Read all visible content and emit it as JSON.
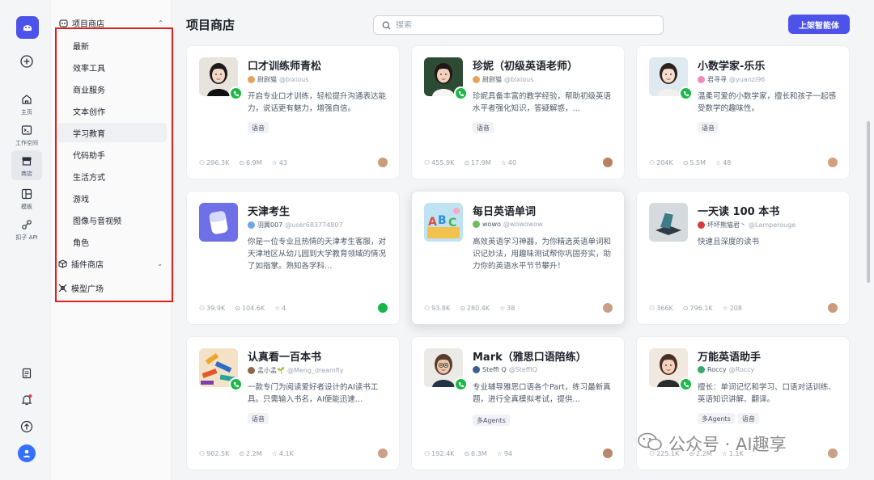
{
  "rail": {
    "items": [
      {
        "label": "主页"
      },
      {
        "label": "工作空间"
      },
      {
        "label": "商店"
      },
      {
        "label": "模板"
      },
      {
        "label": "扣子 API"
      }
    ]
  },
  "sidebar": {
    "project_store": "项目商店",
    "categories": [
      "最新",
      "效率工具",
      "商业服务",
      "文本创作",
      "学习教育",
      "代码助手",
      "生活方式",
      "游戏",
      "图像与音视频",
      "角色"
    ],
    "plugin_store": "插件商店",
    "model_square": "模型广场"
  },
  "header": {
    "title": "项目商店",
    "search_placeholder": "搜索",
    "publish_label": "上架智能体"
  },
  "cards": [
    {
      "title": "口才训练师青松",
      "author": "尉尉猫",
      "handle": "@bixious",
      "desc": "开启专业口才训练，轻松提升沟通表达能力，说话更有魅力，增强自信。",
      "tags": [
        "语音"
      ],
      "users": "296.3K",
      "chats": "6.9M",
      "stars": "43"
    },
    {
      "title": "珍妮（初级英语老师）",
      "author": "尉尉猫",
      "handle": "@bixious",
      "desc": "珍妮具备丰富的教学经验，帮助初级英语水平者强化知识，答疑解惑，…",
      "tags": [
        "语音"
      ],
      "users": "455.9K",
      "chats": "17.9M",
      "stars": "40"
    },
    {
      "title": "小数学家-乐乐",
      "author": "君寻寻",
      "handle": "@yuanzi96",
      "desc": "温柔可爱的小数学家，擅长和孩子一起感受数学的趣味性。",
      "tags": [
        "语音"
      ],
      "users": "204K",
      "chats": "5.5M",
      "stars": "48"
    },
    {
      "title": "天津考生",
      "author": "羽翼007",
      "handle": "@user683774807",
      "desc": "你是一位专业且热情的天津考生客服，对天津地区从幼儿园到大学教育领域的情况了如指掌。熟知各学科…",
      "tags": [],
      "users": "39.9K",
      "chats": "104.6K",
      "stars": "4"
    },
    {
      "title": "每日英语单词",
      "author": "wowo",
      "handle": "@wowowow",
      "desc": "高效英语学习神器，为你精选英语单词和识记妙法，用趣味测试帮你巩固夯实，助力你的英语水平节节攀升！",
      "tags": [],
      "users": "93.8K",
      "chats": "280.4K",
      "stars": "38"
    },
    {
      "title": "一天读 100 本书",
      "author": "坏坏熊猫君丶",
      "handle": "@Lamperouge",
      "desc": "快速且深度的读书",
      "tags": [],
      "users": "366K",
      "chats": "796.1K",
      "stars": "208"
    },
    {
      "title": "认真看一百本书",
      "author": "孟小孟🌱",
      "handle": "@Meng_dreamfly",
      "desc": "一款专门为阅读爱好者设计的AI读书工具。只需输入书名，AI便能迅速…",
      "tags": [
        "语音"
      ],
      "users": "902.5K",
      "chats": "2.2M",
      "stars": "4.1K"
    },
    {
      "title": "Mark（雅思口语陪练）",
      "author": "Steffi Q",
      "handle": "@SteffiQ",
      "desc": "专业辅导雅思口语各个Part，练习最新真题，进行全真模拟考试，提供…",
      "tags": [
        "多Agents"
      ],
      "users": "192.4K",
      "chats": "6.3M",
      "stars": "94"
    },
    {
      "title": "万能英语助手",
      "author": "Roccy",
      "handle": "@Roccy",
      "desc": "擅长：单词记忆和学习、口语对话训练、英语知识讲解、翻译。",
      "tags": [
        "多Agents",
        "语音"
      ],
      "users": "225.1K",
      "chats": "2.2M",
      "stars": "1.1K"
    }
  ],
  "watermark": "公众号 · AI趣享",
  "colors": {
    "accent": "#4d53e8",
    "highlight_box": "#e0201c",
    "phone_badge": "#1cb847"
  }
}
